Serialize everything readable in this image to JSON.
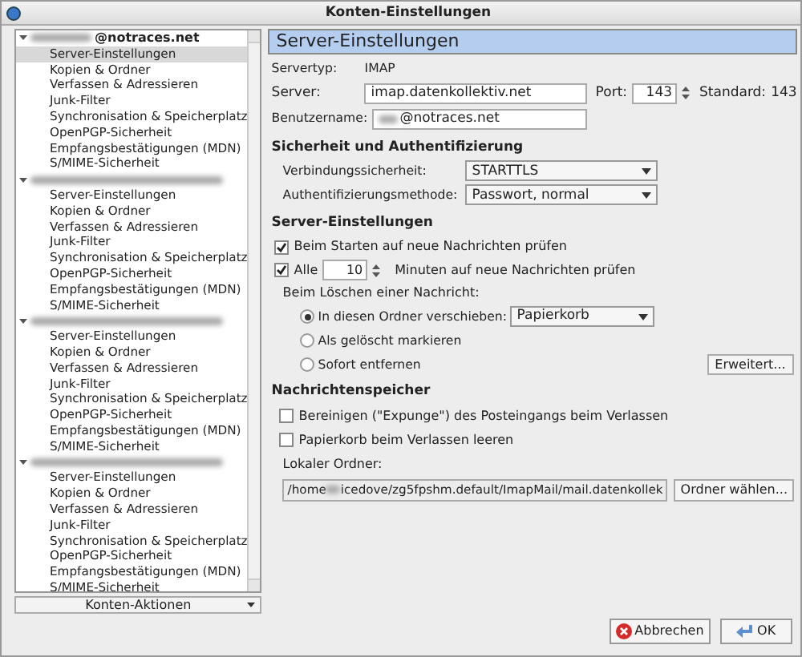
{
  "window": {
    "title": "Konten-Einstellungen"
  },
  "accounts": [
    {
      "name": "@notraces.net",
      "expanded": true,
      "items": [
        {
          "label": "Server-Einstellungen",
          "selected": true
        },
        {
          "label": "Kopien & Ordner",
          "selected": false
        },
        {
          "label": "Verfassen & Adressieren",
          "selected": false
        },
        {
          "label": "Junk-Filter",
          "selected": false
        },
        {
          "label": "Synchronisation & Speicherplatz",
          "selected": false
        },
        {
          "label": "OpenPGP-Sicherheit",
          "selected": false
        },
        {
          "label": "Empfangsbestätigungen (MDN)",
          "selected": false
        },
        {
          "label": "S/MIME-Sicherheit",
          "selected": false
        }
      ]
    },
    {
      "expanded": true,
      "items": [
        {
          "label": "Server-Einstellungen",
          "selected": false
        },
        {
          "label": "Kopien & Ordner",
          "selected": false
        },
        {
          "label": "Verfassen & Adressieren",
          "selected": false
        },
        {
          "label": "Junk-Filter",
          "selected": false
        },
        {
          "label": "Synchronisation & Speicherplatz",
          "selected": false
        },
        {
          "label": "OpenPGP-Sicherheit",
          "selected": false
        },
        {
          "label": "Empfangsbestätigungen (MDN)",
          "selected": false
        },
        {
          "label": "S/MIME-Sicherheit",
          "selected": false
        }
      ]
    },
    {
      "expanded": true,
      "items": [
        {
          "label": "Server-Einstellungen",
          "selected": false
        },
        {
          "label": "Kopien & Ordner",
          "selected": false
        },
        {
          "label": "Verfassen & Adressieren",
          "selected": false
        },
        {
          "label": "Junk-Filter",
          "selected": false
        },
        {
          "label": "Synchronisation & Speicherplatz",
          "selected": false
        },
        {
          "label": "OpenPGP-Sicherheit",
          "selected": false
        },
        {
          "label": "Empfangsbestätigungen (MDN)",
          "selected": false
        },
        {
          "label": "S/MIME-Sicherheit",
          "selected": false
        }
      ]
    },
    {
      "expanded": true,
      "items": [
        {
          "label": "Server-Einstellungen",
          "selected": false
        },
        {
          "label": "Kopien & Ordner",
          "selected": false
        },
        {
          "label": "Verfassen & Adressieren",
          "selected": false
        },
        {
          "label": "Junk-Filter",
          "selected": false
        },
        {
          "label": "Synchronisation & Speicherplatz",
          "selected": false
        },
        {
          "label": "OpenPGP-Sicherheit",
          "selected": false
        },
        {
          "label": "Empfangsbestätigungen (MDN)",
          "selected": false
        },
        {
          "label": "S/MIME-Sicherheit",
          "selected": false
        }
      ]
    }
  ],
  "account_actions": {
    "label": "Konten-Aktionen"
  },
  "panel": {
    "heading": "Server-Einstellungen",
    "server_type": {
      "label": "Servertyp:",
      "value": "IMAP"
    },
    "server": {
      "label": "Server:",
      "value": "imap.datenkollektiv.net"
    },
    "port": {
      "label": "Port:",
      "value": "143"
    },
    "standard": {
      "label": "Standard:",
      "value": "143"
    },
    "username": {
      "label": "Benutzername:",
      "value": "@notraces.net"
    },
    "security": {
      "heading": "Sicherheit und Authentifizierung",
      "selects": [
        {
          "label": "Verbindungssicherheit:",
          "value": "STARTTLS"
        },
        {
          "label": "Authentifizierungsmethode:",
          "value": "Passwort, normal"
        }
      ]
    },
    "server_settings": {
      "heading": "Server-Einstellungen",
      "check_on_start": {
        "label": "Beim Starten auf neue Nachrichten prüfen",
        "checked": true
      },
      "check_every": {
        "label": "Alle",
        "checked": true,
        "value": "10",
        "suffix": "Minuten auf neue Nachrichten prüfen"
      },
      "delete_label": "Beim Löschen einer Nachricht:",
      "delete_options": [
        {
          "label": "In diesen Ordner verschieben:",
          "selected": true,
          "folder": "Papierkorb"
        },
        {
          "label": "Als gelöscht markieren",
          "selected": false
        },
        {
          "label": "Sofort entfernen",
          "selected": false
        }
      ],
      "advanced_button": "Erweitert..."
    },
    "storage": {
      "heading": "Nachrichtenspeicher",
      "options": [
        {
          "label": "Bereinigen (\"Expunge\") des Posteingangs beim Verlassen",
          "checked": false
        },
        {
          "label": "Papierkorb beim Verlassen leeren",
          "checked": false
        }
      ],
      "local_folder_label": "Lokaler Ordner:",
      "path_start": "/home",
      "path_end": "icedove/zg5fpshm.default/ImapMail/mail.datenkollek",
      "choose_button": "Ordner wählen..."
    }
  },
  "buttons": [
    {
      "kind": "cancel",
      "label": "Abbrechen"
    },
    {
      "kind": "ok",
      "label": "OK"
    }
  ]
}
